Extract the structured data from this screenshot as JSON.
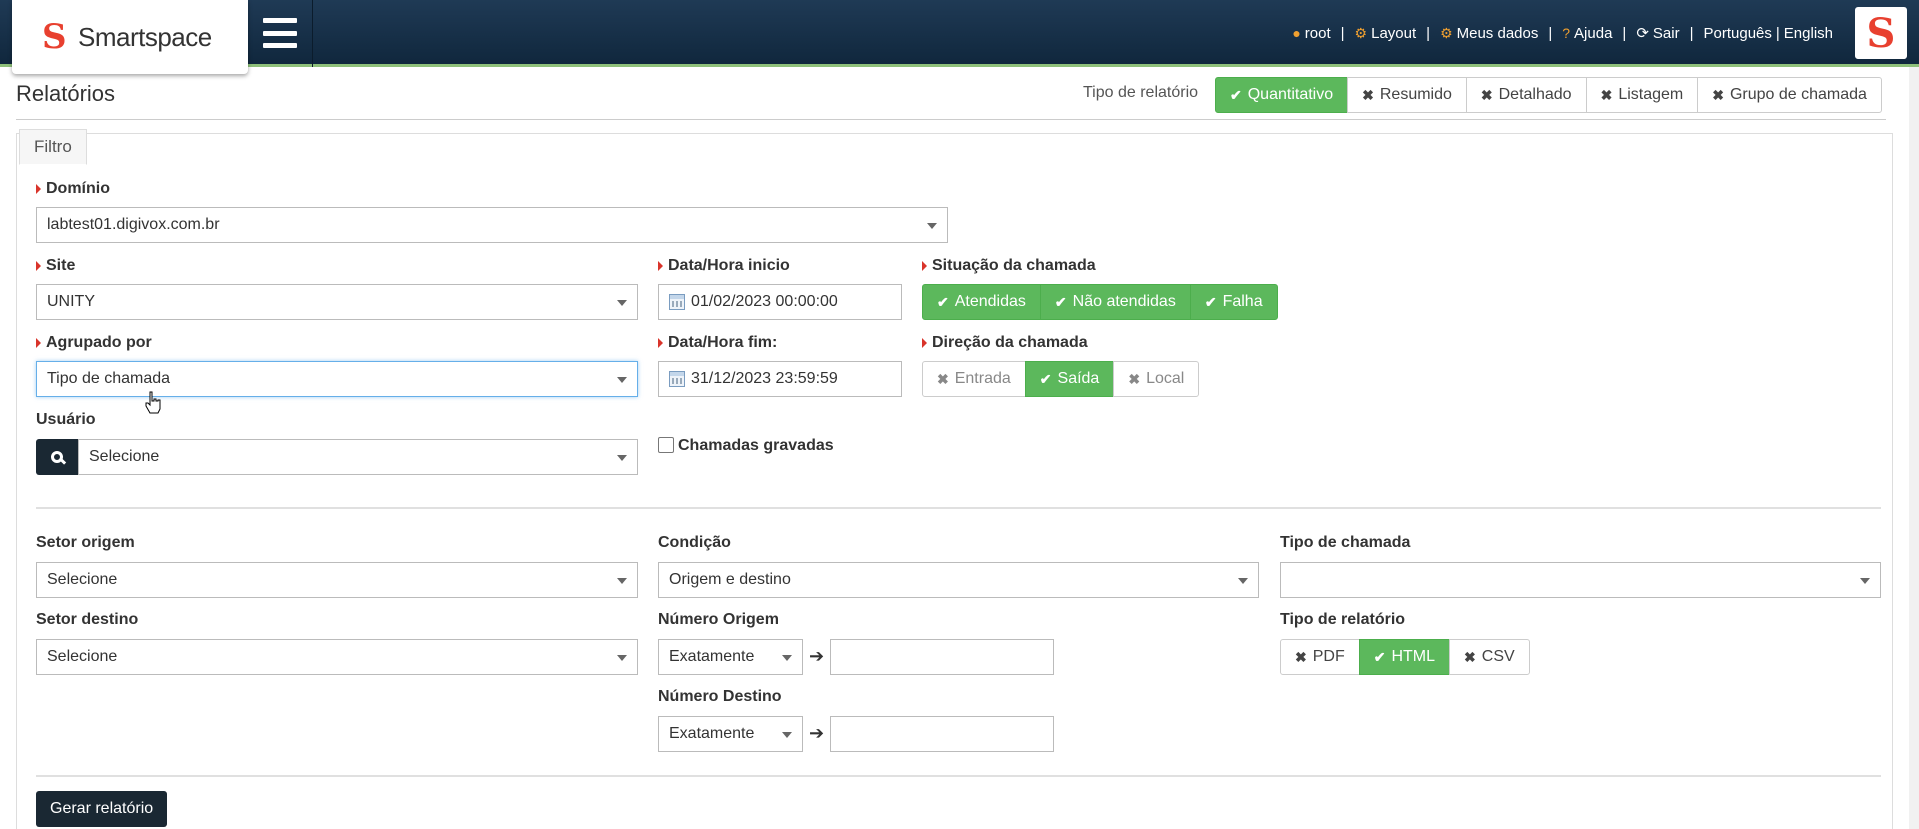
{
  "header": {
    "logo_text": "Smartspace",
    "links": [
      {
        "icon": "user-icon",
        "label": "root"
      },
      {
        "icon": "cogs-icon",
        "label": "Layout"
      },
      {
        "icon": "gear-icon",
        "label": "Meus dados"
      },
      {
        "icon": "question-icon",
        "label": "Ajuda"
      },
      {
        "icon": "logout-icon",
        "label": "Sair"
      }
    ],
    "separator": "|",
    "lang_pt": "Português",
    "lang_en": "English"
  },
  "page": {
    "title": "Relatórios",
    "report_type_label": "Tipo de relatório",
    "report_types": [
      {
        "label": "Quantitativo",
        "active": true
      },
      {
        "label": "Resumido",
        "active": false
      },
      {
        "label": "Detalhado",
        "active": false
      },
      {
        "label": "Listagem",
        "active": false
      },
      {
        "label": "Grupo de chamada",
        "active": false
      }
    ]
  },
  "filter": {
    "tab_label": "Filtro",
    "dominio": {
      "label": "Domínio",
      "value": "labtest01.digivox.com.br"
    },
    "site": {
      "label": "Site",
      "value": "UNITY"
    },
    "agrupado": {
      "label": "Agrupado por",
      "value": "Tipo de chamada"
    },
    "usuario": {
      "label": "Usuário",
      "value": "Selecione"
    },
    "data_inicio": {
      "label": "Data/Hora inicio",
      "value": "01/02/2023 00:00:00"
    },
    "data_fim": {
      "label": "Data/Hora fim:",
      "value": "31/12/2023 23:59:59"
    },
    "gravadas": {
      "label": "Chamadas gravadas",
      "checked": false
    },
    "situacao": {
      "label": "Situação da chamada",
      "options": [
        {
          "label": "Atendidas",
          "active": true
        },
        {
          "label": "Não atendidas",
          "active": true
        },
        {
          "label": "Falha",
          "active": true
        }
      ]
    },
    "direcao": {
      "label": "Direção da chamada",
      "options": [
        {
          "label": "Entrada",
          "active": false
        },
        {
          "label": "Saída",
          "active": true
        },
        {
          "label": "Local",
          "active": false
        }
      ]
    },
    "setor_origem": {
      "label": "Setor origem",
      "value": "Selecione"
    },
    "setor_destino": {
      "label": "Setor destino",
      "value": "Selecione"
    },
    "condicao": {
      "label": "Condição",
      "value": "Origem e destino"
    },
    "numero_origem": {
      "label": "Número Origem",
      "match": "Exatamente",
      "value": ""
    },
    "numero_destino": {
      "label": "Número Destino",
      "match": "Exatamente",
      "value": ""
    },
    "tipo_chamada": {
      "label": "Tipo de chamada",
      "value": ""
    },
    "tipo_relatorio": {
      "label": "Tipo de relatório",
      "options": [
        {
          "label": "PDF",
          "active": false
        },
        {
          "label": "HTML",
          "active": true
        },
        {
          "label": "CSV",
          "active": false
        }
      ]
    },
    "submit_label": "Gerar relatório"
  },
  "colors": {
    "topbar": "#10273d",
    "accent_green": "#5cb85c",
    "brand_red": "#e8402f",
    "dark_button": "#1a2833"
  }
}
